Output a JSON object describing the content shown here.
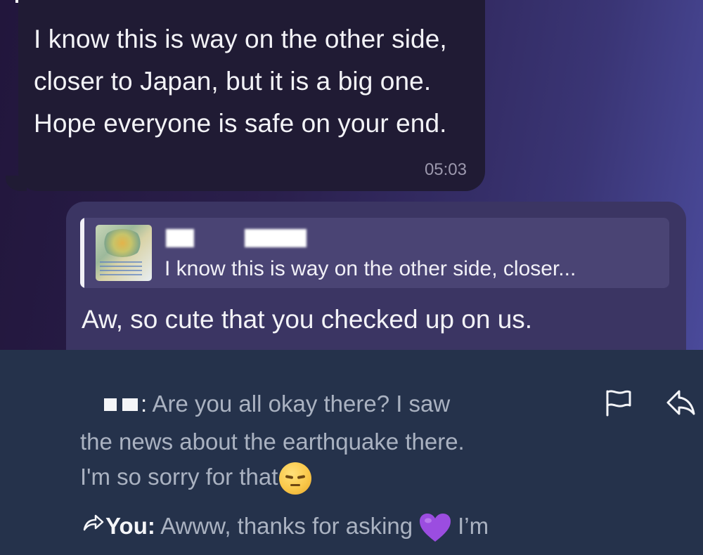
{
  "incoming_message": {
    "text": "I know this is way on the other side, closer to Japan, but it is a big one. Hope everyone is safe on your end.",
    "time": "05:03"
  },
  "outgoing_message": {
    "reply_preview": "I know this is way on the other side, closer...",
    "text": "Aw, so cute that you checked up on us."
  },
  "notification": {
    "sender_suffix": ":",
    "line1": "Are you all okay there? I saw",
    "line2": "the news about the earthquake there.",
    "line3": "I'm so sorry for that",
    "reply_label": "You:",
    "reply_text": "Awww, thanks for asking",
    "reply_tail": "I’m",
    "icons": [
      "flag-icon",
      "share-icon",
      "forward-arrow-icon",
      "sad-face-emoji",
      "purple-heart-emoji"
    ]
  },
  "colors": {
    "incoming_bubble": "#201b34",
    "outgoing_bubble": "#3b3563",
    "notification_bg": "#25324b",
    "heart": "#9b4de0"
  }
}
